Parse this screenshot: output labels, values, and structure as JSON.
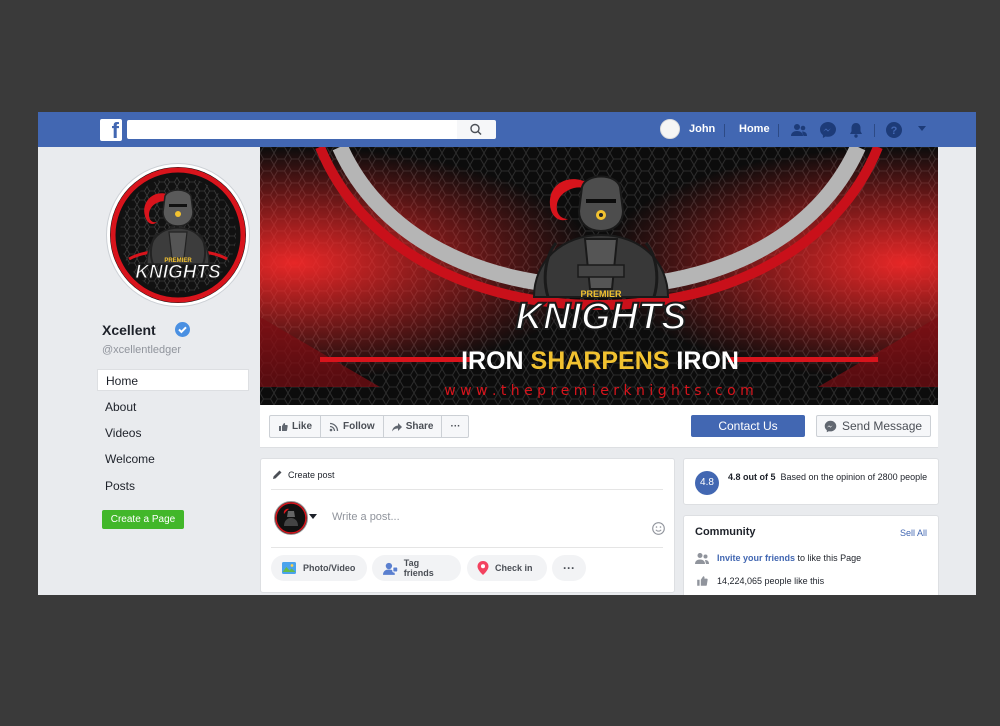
{
  "topbar": {
    "logo": "f",
    "search_placeholder": "",
    "user_name": "John",
    "home_label": "Home",
    "icons": [
      "friends-icon",
      "messenger-icon",
      "notifications-icon",
      "help-icon",
      "chevron-down-icon"
    ]
  },
  "page": {
    "name": "Xcellent",
    "handle": "@xcellentledger",
    "nav": [
      {
        "label": "Home"
      },
      {
        "label": "About"
      },
      {
        "label": "Videos"
      },
      {
        "label": "Welcome"
      },
      {
        "label": "Posts"
      }
    ],
    "create_page": "Create a Page"
  },
  "cover": {
    "brand_small": "PREMIER",
    "brand_big": "KNIGHTS",
    "slogan_a": "IRON",
    "slogan_b": "SHARPENS",
    "slogan_c": "IRON",
    "url": "w w w . t h e p r e m i e r k n i g h t s . c o m"
  },
  "actions": {
    "like": "Like",
    "follow": "Follow",
    "share": "Share",
    "more": "···",
    "contact": "Contact Us",
    "message": "Send Message"
  },
  "post": {
    "title": "Create post",
    "placeholder": "Write a post...",
    "photo": "Photo/Video",
    "tag": "Tag friends",
    "checkin": "Check in",
    "more": "···"
  },
  "rating": {
    "score": "4.8",
    "headline": "4.8 out of 5",
    "detail": "Based  on the opinion of 2800 people"
  },
  "community": {
    "title": "Community",
    "see_all": "Sell All",
    "invite_link": "Invite your friends",
    "invite_rest": "to like this Page",
    "likes": "14,224,065 people like this"
  },
  "colors": {
    "facebook_blue": "#4267b2",
    "brand_red": "#e31b23",
    "brand_gold": "#f2c230",
    "green": "#42b72a"
  }
}
